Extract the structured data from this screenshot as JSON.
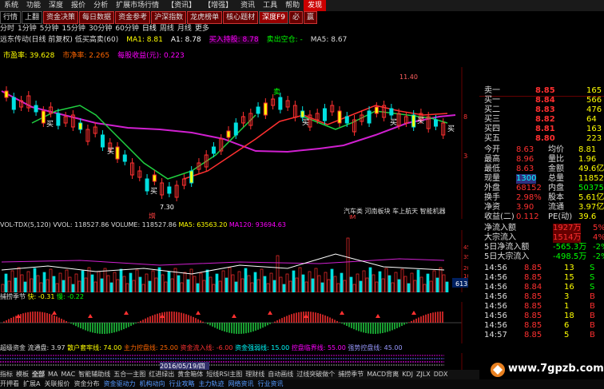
{
  "menu": [
    "系统",
    "功能",
    "深度",
    "报价",
    "分析",
    "扩展市场行情",
    "【资讯】",
    "【增强】",
    "资讯",
    "工具",
    "帮助",
    "发现"
  ],
  "tabs": [
    "行情",
    "上翻",
    "资金决策",
    "每日数据",
    "资金参考",
    "沪深指数",
    "龙虎榜单",
    "核心题材",
    "深度F9",
    "必",
    "赢"
  ],
  "periods": [
    "分时",
    "1分钟",
    "5分钟",
    "15分钟",
    "30分钟",
    "60分钟",
    "日线",
    "周线",
    "月线",
    "更多"
  ],
  "info": {
    "title": "远东传动(日线 前复权) 低买高卖(60)",
    "ma1": "MA1: 8.81",
    "a1": "A1: 8.78",
    "buy_signal": "买入持股: 8.78",
    "sell_space": "卖出空仓: -",
    "ma5": "MA5: 8.67"
  },
  "pe": {
    "dynamic": "市盈率: 39.628",
    "pb": "市净率: 2.265",
    "eps": "每股收益(元): 0.223"
  },
  "main_chart": {
    "labels": {
      "high": "11.40",
      "low": "7.30",
      "zeng": "增",
      "cai": "财",
      "rp1": "81.8%",
      "rp2": "38.2%"
    },
    "buy_marks": [
      "买",
      "买",
      "买",
      "买",
      "买",
      "买",
      "买"
    ],
    "sell_mark": "卖",
    "concept": "汽车类 河南板块 车上航天 智能机器"
  },
  "vol": {
    "title": "VOL-TDX(5,120)",
    "vvol": "VVOL: 118527.86",
    "volume": "VOLUME: 118527.86",
    "ma5": "MA5: 63563.20",
    "ma120": "MA120: 93694.63",
    "axis": [
      "45000",
      "35000",
      "20000",
      "10000"
    ],
    "right_box": "6132"
  },
  "catch": {
    "title": "捕捞季节",
    "fast": "快: -0.31",
    "slow": "慢: -0.22"
  },
  "super": {
    "title": "超级资金",
    "fund": "流通盘: 3.97",
    "bull": "散户套牢线: 74.00",
    "main": "主力控盘线: 25.00",
    "inflow": "资金流入线: -6.00",
    "flow": "资金强弱线: 15.00",
    "ctrl": "控盘临界线: 55.00",
    "strong": "强势控盘线: 45.00",
    "date": "2016/05/19/四"
  },
  "quote": {
    "ask": [
      {
        "label": "卖一",
        "price": "8.85",
        "vol": "165"
      }
    ],
    "rows": [
      {
        "l": "卖一",
        "v": "8.85",
        "r": "165"
      },
      {
        "l": "买一",
        "v": "8.84",
        "r": "566"
      },
      {
        "l": "买二",
        "v": "8.83",
        "r": "476"
      },
      {
        "l": "买三",
        "v": "8.82",
        "r": "64"
      },
      {
        "l": "买四",
        "v": "8.81",
        "r": "163"
      },
      {
        "l": "买五",
        "v": "8.80",
        "r": "223"
      }
    ],
    "stats": [
      {
        "a": "今开",
        "b": "8.63",
        "c": "均价",
        "d": "8.81"
      },
      {
        "a": "最高",
        "b": "8.96",
        "c": "量比",
        "d": "1.96"
      },
      {
        "a": "最低",
        "b": "8.63",
        "c": "金额",
        "d": "49.6亿"
      },
      {
        "a": "现量",
        "b": "1300",
        "c": "总量",
        "d": "118527"
      },
      {
        "a": "外盘",
        "b": "68152",
        "c": "内盘",
        "d": "50375"
      },
      {
        "a": "换手",
        "b": "2.98%",
        "c": "股本",
        "d": "5.61亿"
      },
      {
        "a": "净资",
        "b": "3.90",
        "c": "流通",
        "d": "3.97亿"
      },
      {
        "a": "收益(二)",
        "b": "0.112",
        "c": "PE(动)",
        "d": "39.6"
      }
    ],
    "flow": [
      {
        "a": "净流入额",
        "b": "1927万",
        "c": "5%"
      },
      {
        "a": "大宗流入",
        "b": "1514万",
        "c": "4%"
      },
      {
        "a": "5日净流入额",
        "b": "-565.3万",
        "c": "-2%"
      },
      {
        "a": "5日大宗流入",
        "b": "-498.5万",
        "c": "-2%"
      }
    ],
    "ticks": [
      {
        "t": "14:56",
        "p": "8.85",
        "v": "13",
        "s": "S"
      },
      {
        "t": "14:56",
        "p": "8.85",
        "v": "15",
        "s": "S"
      },
      {
        "t": "14:56",
        "p": "8.84",
        "v": "16",
        "s": "S"
      },
      {
        "t": "14:56",
        "p": "8.85",
        "v": "3",
        "s": "B"
      },
      {
        "t": "14:56",
        "p": "8.85",
        "v": "1",
        "s": "B"
      },
      {
        "t": "14:56",
        "p": "8.85",
        "v": "18",
        "s": "B"
      },
      {
        "t": "14:56",
        "p": "8.85",
        "v": "6",
        "s": "B"
      },
      {
        "t": "14:57",
        "p": "8.85",
        "v": "5",
        "s": "B"
      }
    ]
  },
  "bottom": [
    "指标",
    "模板",
    "全部",
    "MA",
    "MAC",
    "智能辅助线",
    "五合一主图",
    "红进绿出",
    "黄金箱体",
    "短线RSI主图",
    "理财线",
    "自动画线",
    "过线突破做个",
    "捕捞季节",
    "MACD背离",
    "KDJ",
    "ZJLX",
    "DDX"
  ],
  "bottom2": [
    "开押看",
    "扩展A",
    "关联报价",
    "资金分布",
    "资金驱动力",
    "机构动向",
    "行业攻略",
    "主力轨迹",
    "网络资讯",
    "行业资讯"
  ],
  "right_tabs": [
    "日线",
    "笔",
    "价",
    "细",
    "势",
    "联",
    "值",
    "主"
  ],
  "watermark": "www.7gpzb.com",
  "status_right": "图文F10",
  "status_box": "集合交投"
}
